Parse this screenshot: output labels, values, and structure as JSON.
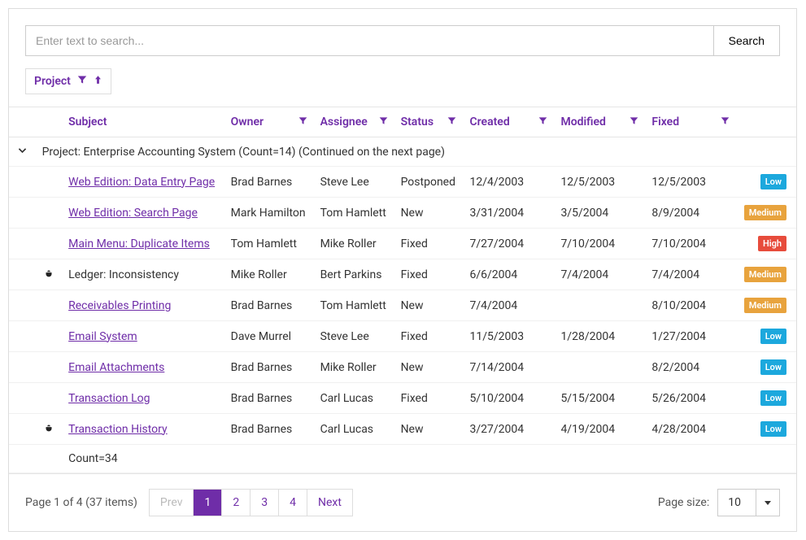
{
  "search": {
    "placeholder": "Enter text to search...",
    "button": "Search"
  },
  "filterChip": {
    "label": "Project"
  },
  "columns": {
    "subject": "Subject",
    "owner": "Owner",
    "assignee": "Assignee",
    "status": "Status",
    "created": "Created",
    "modified": "Modified",
    "fixed": "Fixed"
  },
  "group": {
    "header": "Project: Enterprise Accounting System (Count=14) (Continued on the next page)",
    "footer": "Count=34"
  },
  "rows": [
    {
      "bug": false,
      "subject": "Web Edition: Data Entry Page",
      "linked": true,
      "owner": "Brad Barnes",
      "assignee": "Steve Lee",
      "status": "Postponed",
      "created": "12/4/2003",
      "modified": "12/5/2003",
      "fixed": "12/5/2003",
      "priority": "Low"
    },
    {
      "bug": false,
      "subject": "Web Edition: Search Page",
      "linked": true,
      "owner": "Mark Hamilton",
      "assignee": "Tom Hamlett",
      "status": "New",
      "created": "3/31/2004",
      "modified": "3/5/2004",
      "fixed": "8/9/2004",
      "priority": "Medium"
    },
    {
      "bug": false,
      "subject": "Main Menu: Duplicate Items",
      "linked": true,
      "owner": "Tom Hamlett",
      "assignee": "Mike Roller",
      "status": "Fixed",
      "created": "7/27/2004",
      "modified": "7/10/2004",
      "fixed": "7/10/2004",
      "priority": "High"
    },
    {
      "bug": true,
      "subject": "Ledger: Inconsistency",
      "linked": false,
      "owner": "Mike Roller",
      "assignee": "Bert Parkins",
      "status": "Fixed",
      "created": "6/6/2004",
      "modified": "7/4/2004",
      "fixed": "7/4/2004",
      "priority": "Medium"
    },
    {
      "bug": false,
      "subject": "Receivables Printing",
      "linked": true,
      "owner": "Brad Barnes",
      "assignee": "Tom Hamlett",
      "status": "New",
      "created": "7/4/2004",
      "modified": "",
      "fixed": "8/10/2004",
      "priority": "Medium"
    },
    {
      "bug": false,
      "subject": "Email System",
      "linked": true,
      "owner": "Dave Murrel",
      "assignee": "Steve Lee",
      "status": "Fixed",
      "created": "11/5/2003",
      "modified": "1/28/2004",
      "fixed": "1/27/2004",
      "priority": "Low"
    },
    {
      "bug": false,
      "subject": "Email Attachments",
      "linked": true,
      "owner": "Brad Barnes",
      "assignee": "Mike Roller",
      "status": "New",
      "created": "7/14/2004",
      "modified": "",
      "fixed": "8/2/2004",
      "priority": "Low"
    },
    {
      "bug": false,
      "subject": "Transaction Log",
      "linked": true,
      "owner": "Brad Barnes",
      "assignee": "Carl Lucas",
      "status": "Fixed",
      "created": "5/10/2004",
      "modified": "5/15/2004",
      "fixed": "5/26/2004",
      "priority": "Low"
    },
    {
      "bug": true,
      "subject": "Transaction History",
      "linked": true,
      "owner": "Brad Barnes",
      "assignee": "Carl Lucas",
      "status": "New",
      "created": "3/27/2004",
      "modified": "4/19/2004",
      "fixed": "4/28/2004",
      "priority": "Low"
    }
  ],
  "pager": {
    "info": "Page 1 of 4 (37 items)",
    "prev": "Prev",
    "next": "Next",
    "pages": [
      "1",
      "2",
      "3",
      "4"
    ],
    "active": "1",
    "sizeLabel": "Page size:",
    "sizeValue": "10"
  }
}
